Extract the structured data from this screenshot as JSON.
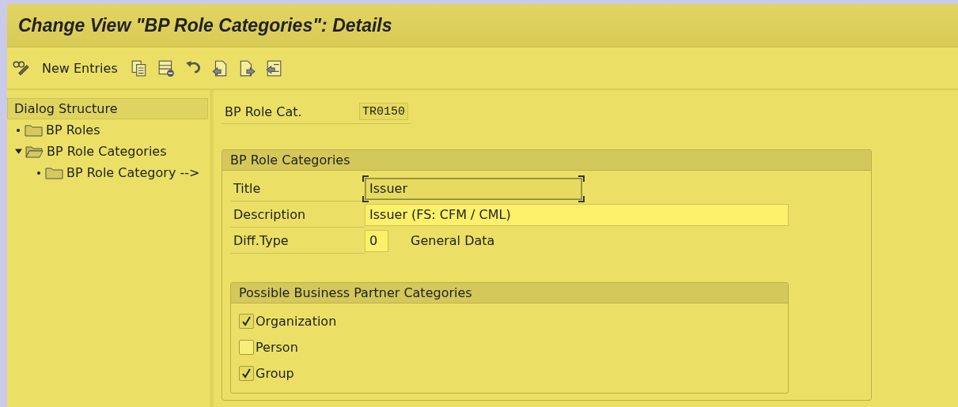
{
  "window": {
    "title": "Change View \"BP Role Categories\": Details"
  },
  "toolbar": {
    "items": [
      {
        "kind": "icon"
      },
      {
        "kind": "text",
        "label": "New Entries"
      },
      {
        "kind": "icon"
      },
      {
        "kind": "icon"
      },
      {
        "kind": "icon"
      },
      {
        "kind": "icon"
      },
      {
        "kind": "icon"
      },
      {
        "kind": "icon"
      }
    ]
  },
  "dialog_structure": {
    "title": "Dialog Structure",
    "items": [
      {
        "label": "BP Roles"
      },
      {
        "label": "BP Role Categories",
        "expanded": true,
        "children": [
          {
            "label": "BP Role Category -->"
          }
        ]
      }
    ]
  },
  "key_field": {
    "label": "BP Role Cat.",
    "value": "TR0150"
  },
  "group": {
    "title": "BP Role Categories",
    "fields": [
      {
        "label": "Title",
        "value": "Issuer",
        "editable": false,
        "focused": true
      },
      {
        "label": "Description",
        "value": "Issuer (FS: CFM / CML)",
        "editable": true,
        "focused": false
      },
      {
        "label": "Diff.Type",
        "value": "0",
        "editable": true,
        "focused": false,
        "note": "General Data"
      }
    ]
  },
  "categories": {
    "title": "Possible Business Partner Categories",
    "options": [
      {
        "label": "Organization",
        "checked": true
      },
      {
        "label": "Person",
        "checked": false
      },
      {
        "label": "Group",
        "checked": true
      }
    ]
  }
}
